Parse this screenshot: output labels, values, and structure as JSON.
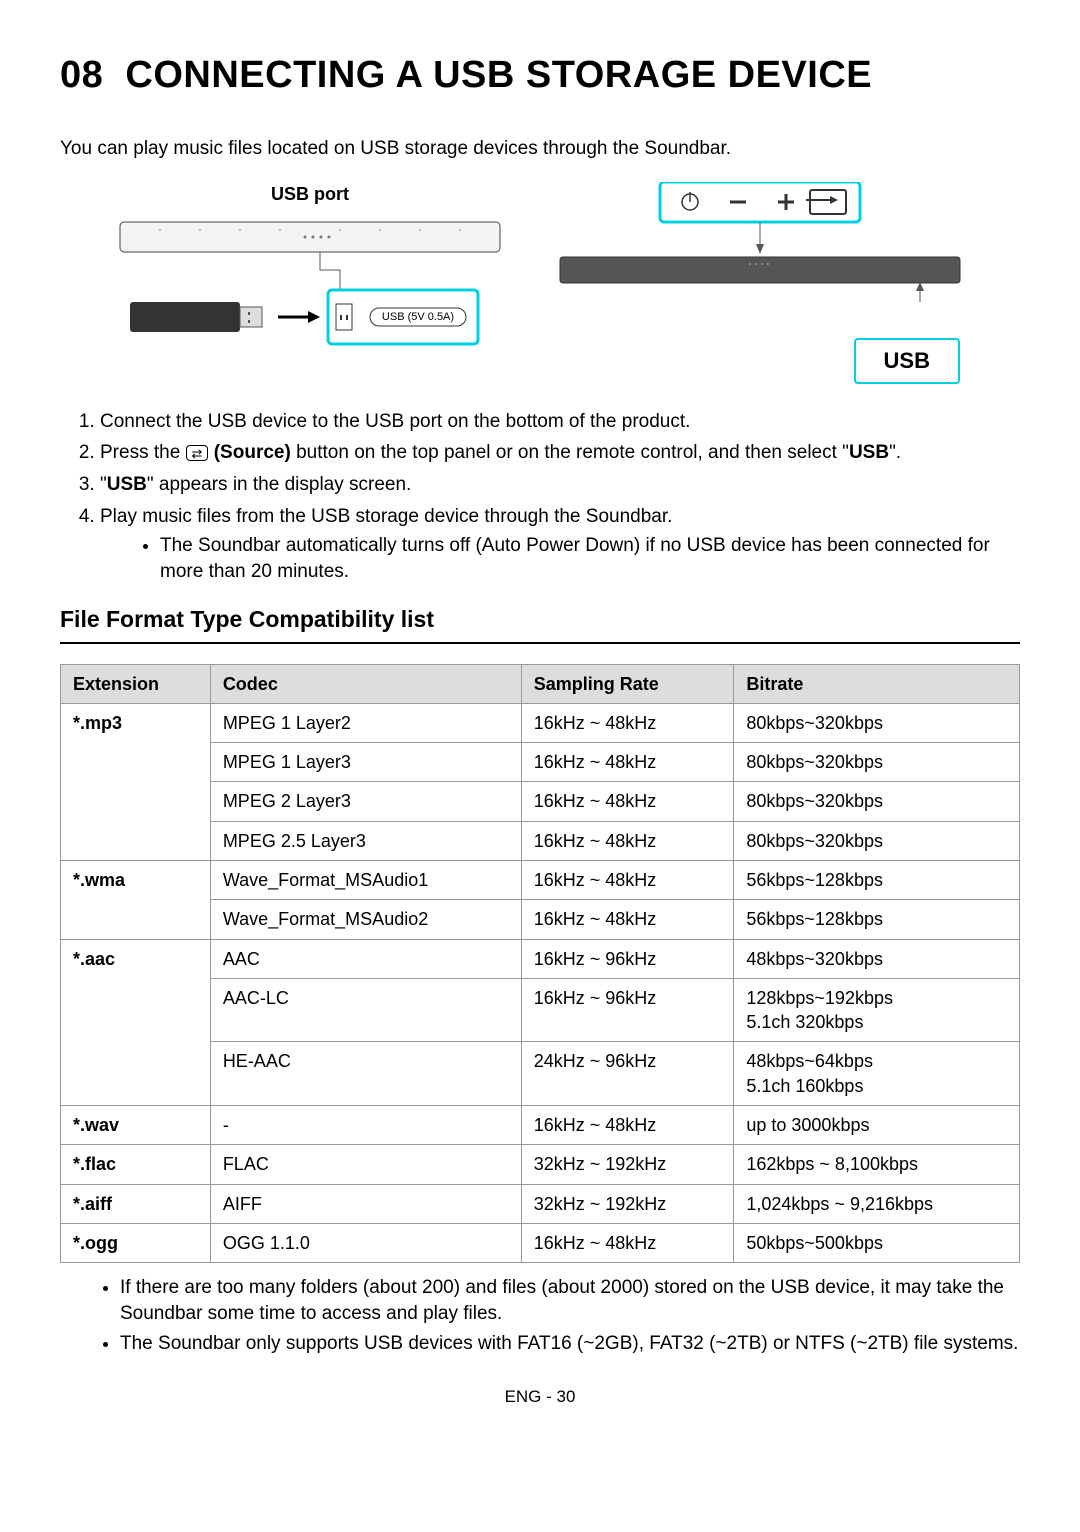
{
  "chapter_num": "08",
  "chapter_title": "CONNECTING A USB STORAGE DEVICE",
  "intro": "You can play music files located on USB storage devices through the Soundbar.",
  "usb_port_label": "USB port",
  "usb_spec": "USB (5V 0.5A)",
  "usb_display": "USB",
  "steps": {
    "s1": "Connect the USB device to the USB port on the bottom of the product.",
    "s2a": "Press the ",
    "s2_source": "(Source)",
    "s2b": " button on the top panel or on the remote control, and then select \"",
    "s2_usb": "USB",
    "s2c": "\".",
    "s3a": "\"",
    "s3_usb": "USB",
    "s3b": "\" appears in the display screen.",
    "s4": "Play music files from the USB storage device through the Soundbar.",
    "s4_sub": "The Soundbar automatically turns off (Auto Power Down) if no USB device has been connected for more than 20 minutes."
  },
  "table_title": "File Format Type Compatibility list",
  "columns": {
    "c1": "Extension",
    "c2": "Codec",
    "c3": "Sampling Rate",
    "c4": "Bitrate"
  },
  "rows": [
    {
      "ext": "*.mp3",
      "ext_rowspan": 4,
      "codec": "MPEG 1 Layer2",
      "rate": "16kHz ~ 48kHz",
      "bitrate": "80kbps~320kbps"
    },
    {
      "codec": "MPEG 1 Layer3",
      "rate": "16kHz ~ 48kHz",
      "bitrate": "80kbps~320kbps"
    },
    {
      "codec": "MPEG 2 Layer3",
      "rate": "16kHz ~ 48kHz",
      "bitrate": "80kbps~320kbps"
    },
    {
      "codec": "MPEG 2.5 Layer3",
      "rate": "16kHz ~ 48kHz",
      "bitrate": "80kbps~320kbps"
    },
    {
      "ext": "*.wma",
      "ext_rowspan": 2,
      "codec": "Wave_Format_MSAudio1",
      "rate": "16kHz ~ 48kHz",
      "bitrate": "56kbps~128kbps"
    },
    {
      "codec": "Wave_Format_MSAudio2",
      "rate": "16kHz ~ 48kHz",
      "bitrate": "56kbps~128kbps"
    },
    {
      "ext": "*.aac",
      "ext_rowspan": 3,
      "codec": "AAC",
      "rate": "16kHz ~ 96kHz",
      "bitrate": "48kbps~320kbps"
    },
    {
      "codec": "AAC-LC",
      "rate": "16kHz ~ 96kHz",
      "bitrate": "128kbps~192kbps\n5.1ch 320kbps"
    },
    {
      "codec": "HE-AAC",
      "rate": "24kHz ~ 96kHz",
      "bitrate": "48kbps~64kbps\n5.1ch 160kbps"
    },
    {
      "ext": "*.wav",
      "ext_rowspan": 1,
      "codec": "-",
      "rate": "16kHz ~ 48kHz",
      "bitrate": "up to 3000kbps"
    },
    {
      "ext": "*.flac",
      "ext_rowspan": 1,
      "codec": "FLAC",
      "rate": "32kHz ~ 192kHz",
      "bitrate": "162kbps ~ 8,100kbps"
    },
    {
      "ext": "*.aiff",
      "ext_rowspan": 1,
      "codec": "AIFF",
      "rate": "32kHz ~ 192kHz",
      "bitrate": "1,024kbps ~ 9,216kbps"
    },
    {
      "ext": "*.ogg",
      "ext_rowspan": 1,
      "codec": "OGG 1.1.0",
      "rate": "16kHz ~ 48kHz",
      "bitrate": "50kbps~500kbps"
    }
  ],
  "notes": {
    "n1": "If there are too many folders (about 200) and files (about 2000) stored on the USB device, it may take the Soundbar some time to access and play files.",
    "n2": "The Soundbar only supports USB devices with FAT16 (~2GB), FAT32 (~2TB) or NTFS (~2TB) file systems."
  },
  "pagefoot": "ENG - 30"
}
